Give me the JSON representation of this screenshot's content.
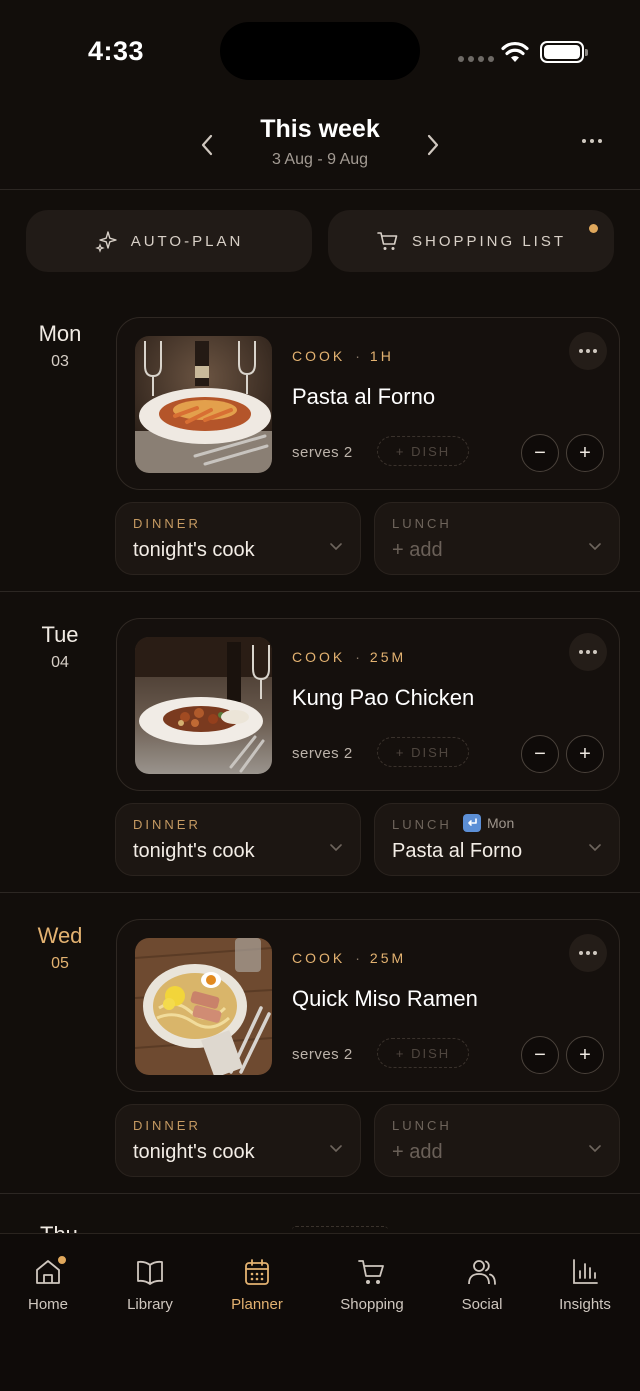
{
  "status": {
    "time": "4:33"
  },
  "header": {
    "title": "This week",
    "range": "3 Aug - 9 Aug"
  },
  "actions": {
    "auto_plan": "AUTO-PLAN",
    "shopping_list": "SHOPPING LIST"
  },
  "days": [
    {
      "name": "Mon",
      "num": "03",
      "card": {
        "mode": "COOK",
        "duration": "1H",
        "title": "Pasta al Forno",
        "serves": "serves 2",
        "dish_chip": "+ DISH"
      },
      "dinner": {
        "label": "DINNER",
        "value": "tonight's cook"
      },
      "lunch": {
        "label": "LUNCH",
        "value": "+ add",
        "leftover_from": ""
      }
    },
    {
      "name": "Tue",
      "num": "04",
      "card": {
        "mode": "COOK",
        "duration": "25M",
        "title": "Kung Pao Chicken",
        "serves": "serves 2",
        "dish_chip": "+ DISH"
      },
      "dinner": {
        "label": "DINNER",
        "value": "tonight's cook"
      },
      "lunch": {
        "label": "LUNCH",
        "value": "Pasta al Forno",
        "leftover_from": "Mon"
      }
    },
    {
      "name": "Wed",
      "num": "05",
      "card": {
        "mode": "COOK",
        "duration": "25M",
        "title": "Quick Miso Ramen",
        "serves": "serves 2",
        "dish_chip": "+ DISH"
      },
      "dinner": {
        "label": "DINNER",
        "value": "tonight's cook"
      },
      "lunch": {
        "label": "LUNCH",
        "value": "+ add",
        "leftover_from": ""
      }
    }
  ],
  "partial_day": "Thu",
  "tabs": [
    {
      "label": "Home",
      "icon": "home-icon"
    },
    {
      "label": "Library",
      "icon": "book-icon"
    },
    {
      "label": "Planner",
      "icon": "calendar-icon"
    },
    {
      "label": "Shopping",
      "icon": "cart-icon"
    },
    {
      "label": "Social",
      "icon": "people-icon"
    },
    {
      "label": "Insights",
      "icon": "bar-chart-icon"
    }
  ],
  "colors": {
    "accent": "#e3b271",
    "background": "#120e0b",
    "card": "#1c1612"
  }
}
